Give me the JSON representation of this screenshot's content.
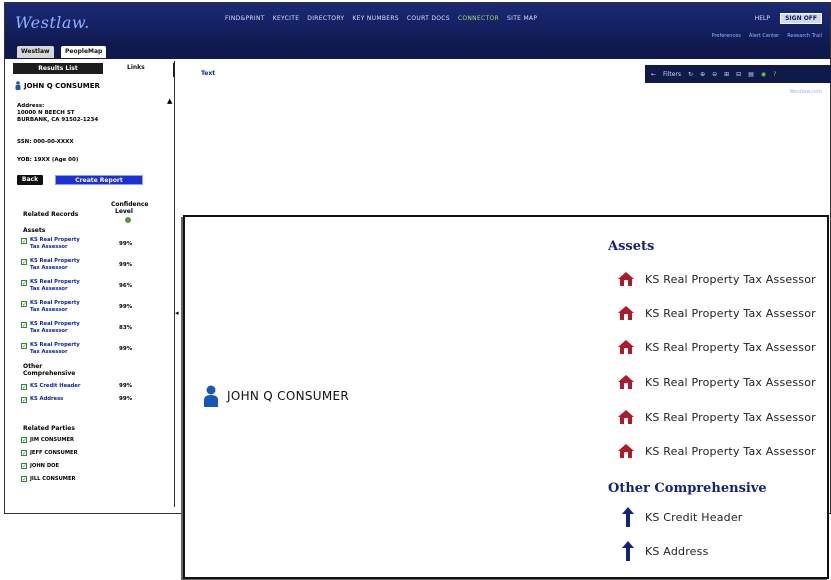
{
  "app": {
    "logo": "Westlaw.",
    "nav": [
      "FIND&PRINT",
      "KEYCITE",
      "DIRECTORY",
      "KEY NUMBERS",
      "COURT DOCS",
      "CONNECTOR",
      "SITE MAP"
    ],
    "active_nav": "CONNECTOR",
    "help": "HELP",
    "signoff": "SIGN OFF",
    "sublinks": [
      "Preferences",
      "Alert Center",
      "Research Trail"
    ],
    "sublink_right": "Westlaw.com",
    "tabs": [
      "Westlaw",
      "PeopleMap"
    ]
  },
  "sidebar": {
    "results_tab": "Results List",
    "links_tab": "Links",
    "person_name": "JOHN Q CONSUMER",
    "address_label": "Address:",
    "address_line1": "10000 N BEECH ST",
    "address_line2": "BURBANK, CA 91502-1234",
    "ssn": "SSN: 000-00-XXXX",
    "yob": "YOB: 19XX (Age 00)",
    "back_button": "Back",
    "create_report_button": "Create Report",
    "related_records_label": "Related Records",
    "confidence_label_1": "Confidence",
    "confidence_label_2": "Level",
    "assets_label": "Assets",
    "other_label_1": "Other",
    "other_label_2": "Comprehensive",
    "related_parties_label": "Related Parties",
    "records": [
      {
        "line1": "KS Real Property",
        "line2": "Tax Assessor",
        "pct": "99%"
      },
      {
        "line1": "KS Real Property",
        "line2": "Tax Assessor",
        "pct": "99%"
      },
      {
        "line1": "KS Real Property",
        "line2": "Tax Assessor",
        "pct": "96%"
      },
      {
        "line1": "KS Real Property",
        "line2": "Tax Assessor",
        "pct": "99%"
      },
      {
        "line1": "KS Real Property",
        "line2": "Tax Assessor",
        "pct": "83%"
      },
      {
        "line1": "KS Real Property",
        "line2": "Tax Assessor",
        "pct": "99%"
      }
    ],
    "other_records": [
      {
        "line1": "KS Credit Header",
        "pct": "99%"
      },
      {
        "line1": "KS Address",
        "pct": "99%"
      }
    ],
    "parties": [
      "JIM CONSUMER",
      "JEFF CONSUMER",
      "JOHN DOE",
      "JILL CONSUMER"
    ]
  },
  "main": {
    "text_link": "Text",
    "toolbar": [
      "←",
      "Filters",
      "↻",
      "⊕",
      "⊖",
      "⊞",
      "⊟",
      "▤",
      "◉",
      "?"
    ]
  },
  "graph": {
    "person_name": "JOHN Q CONSUMER",
    "assets_title": "Assets",
    "assets": [
      "KS Real Property Tax Assessor",
      "KS Real Property Tax Assessor",
      "KS Real Property Tax Assessor",
      "KS Real Property Tax Assessor",
      "KS Real Property Tax Assessor",
      "KS Real Property Tax Assessor"
    ],
    "other_title": "Other Comprehensive",
    "other": [
      "KS Credit Header",
      "KS Address"
    ],
    "colors": {
      "asset_icon": "#b0192a",
      "person_icon": "#1b55b8",
      "title": "#12237a"
    }
  }
}
